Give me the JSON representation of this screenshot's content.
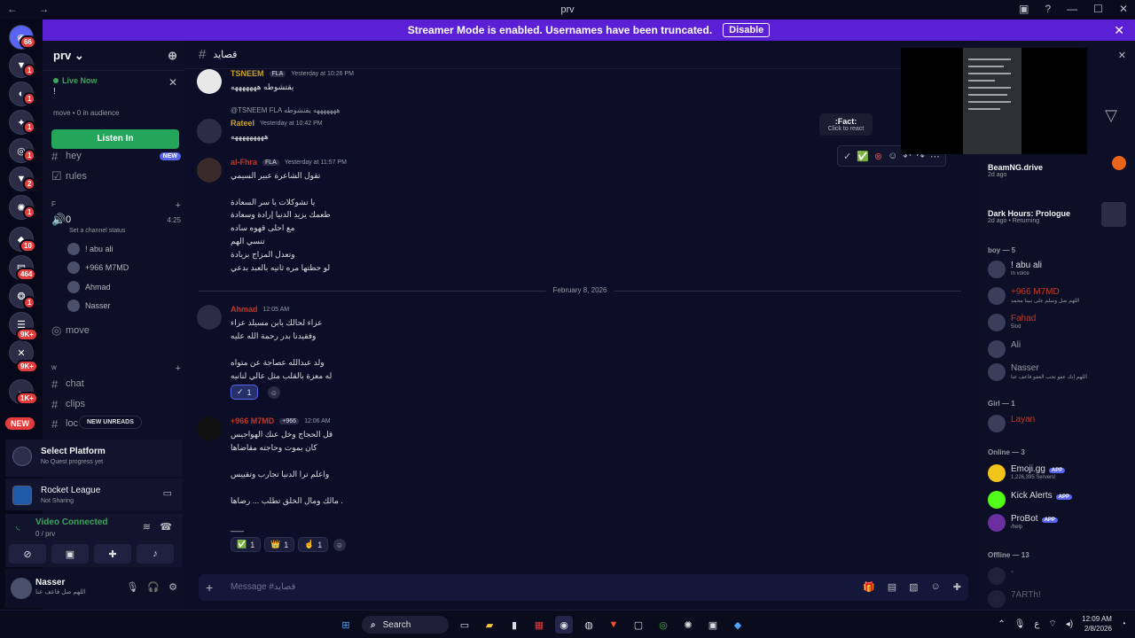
{
  "titlebar": {
    "title": "prv"
  },
  "banner": {
    "text": "Streamer Mode is enabled. Usernames have been truncated.",
    "disable": "Disable"
  },
  "rail": {
    "home_badge": "66",
    "new_label": "NEW",
    "badges": [
      "1",
      "1",
      "1",
      "1",
      "1",
      "2",
      "1",
      "10",
      "464",
      "1",
      "9K+",
      "9K+",
      "1K+"
    ]
  },
  "server": {
    "name": "prv",
    "live": {
      "label": "Live Now",
      "excl": "!",
      "audience": "move • 0 in audience",
      "listen": "Listen In"
    },
    "channels_top": [
      {
        "name": "hey",
        "tag": "NEW"
      },
      {
        "name": "rules"
      }
    ],
    "category_f": "F",
    "voice": {
      "name": "0",
      "time": "4:25",
      "status": "Set a channel status",
      "users": [
        "! abu ali",
        "+966 M7MD",
        "Ahmad",
        "Nasser"
      ]
    },
    "move_channel": "move",
    "category_w": "w",
    "channels_w": [
      "chat",
      "clips",
      "loc"
    ],
    "new_unreads": "NEW UNREADS"
  },
  "quest": {
    "title": "Select Platform",
    "subtitle": "No Quest progress yet"
  },
  "game": {
    "title": "Rocket League",
    "subtitle": "Not Sharing"
  },
  "voice_conn": {
    "title": "Video Connected",
    "sub": "0 / prv"
  },
  "user": {
    "name": "Nasser",
    "status": "اللهم صل فاعف عنا"
  },
  "channel": {
    "name": "قصايد",
    "placeholder": "Message #قصايد"
  },
  "messages": [
    {
      "author": "TSNEEM",
      "tag": "FLA",
      "time": "Yesterday at 10:26 PM",
      "body": "يقتشوطه هههههههه",
      "color": "#c9a227"
    },
    {
      "reply": "@TSNEEM  FLA  هههههههه يقتشوطه",
      "author": "Rateel",
      "time": "Yesterday at 10:42 PM",
      "body": "هههههههههه",
      "color": "#c9a227"
    },
    {
      "author": "al-Fhra",
      "tag": "FLA",
      "time": "Yesterday at 11:57 PM",
      "color": "#c0392b",
      "body": "تقول الشاعرة عبير السيمي\n\nيا تشوكلات يا سر السعادة\nطعمك يزيد الدنيا إرادة وسعادة\nمع احلى قهوه ساده\nتنسي الهم\nوتعدل المزاج بزيادة\nلو حطتها مره ثانيه بالعبد بدعي"
    }
  ],
  "date_divider": "February 8, 2026",
  "messages2": [
    {
      "author": "Ahmad",
      "time": "12:05 AM",
      "color": "#c0392b",
      "body": "عزاء لحالك يابن مسيلد عزاء\nوفقيدنا بدر رحمة الله عليه\n\nولد عبدالله عصاجة عن متواه\nله معزة بالقلب مثل عالي لنانيه",
      "reactions": [
        {
          "e": "✓",
          "n": "1"
        }
      ]
    },
    {
      "author": "+966 M7MD",
      "tag": "+966",
      "time": "12:06 AM",
      "color": "#c0392b",
      "body": "قل الحجاج وخل عنك الهواجيس\nكان يموت وحاجته مقاضاها\n\nواعلم ترا الدنيا تجارب وتقييس\n\nمالك ومال الخلق تطلب ... رضاها .\n\n___",
      "reactions": [
        {
          "e": "✅",
          "n": "1"
        },
        {
          "e": "👑",
          "n": "1"
        },
        {
          "e": "☝",
          "n": "1"
        }
      ]
    }
  ],
  "tooltip": {
    "title": ":Fact:",
    "sub": "Click to react"
  },
  "activities": [
    {
      "title": "BeamNG.drive",
      "sub": "2d ago"
    },
    {
      "title": "Dark Hours: Prologue",
      "sub": "2d ago  • Returning"
    }
  ],
  "groups": [
    {
      "label": "boy — 5",
      "members": [
        {
          "name": "! abu ali",
          "status": "In voice"
        },
        {
          "name": "+966 M7MD",
          "status": "اللهم صل وسلم على نبينا محمد"
        },
        {
          "name": "Fahad",
          "status": "5lod"
        },
        {
          "name": "Ali",
          "status": ""
        },
        {
          "name": "Nasser",
          "status": "اللهم إنك عفو تحب العفو فاعف عنا"
        }
      ]
    },
    {
      "label": "Girl — 1",
      "members": [
        {
          "name": "Layan",
          "status": ""
        }
      ]
    },
    {
      "label": "Online — 3",
      "members": [
        {
          "name": "Emoji.gg",
          "status": "1,226,395 Servers!",
          "app": "APP"
        },
        {
          "name": "Kick Alerts",
          "status": "",
          "app": "APP"
        },
        {
          "name": "ProBot",
          "status": "/help",
          "app": "APP"
        }
      ]
    },
    {
      "label": "Offline — 13",
      "members": [
        {
          "name": "-",
          "status": ""
        },
        {
          "name": "7ARTh!",
          "status": ""
        }
      ]
    }
  ],
  "taskbar": {
    "search": "Search",
    "time": "12:09 AM",
    "date": "2/8/2026",
    "lang": "ع"
  }
}
